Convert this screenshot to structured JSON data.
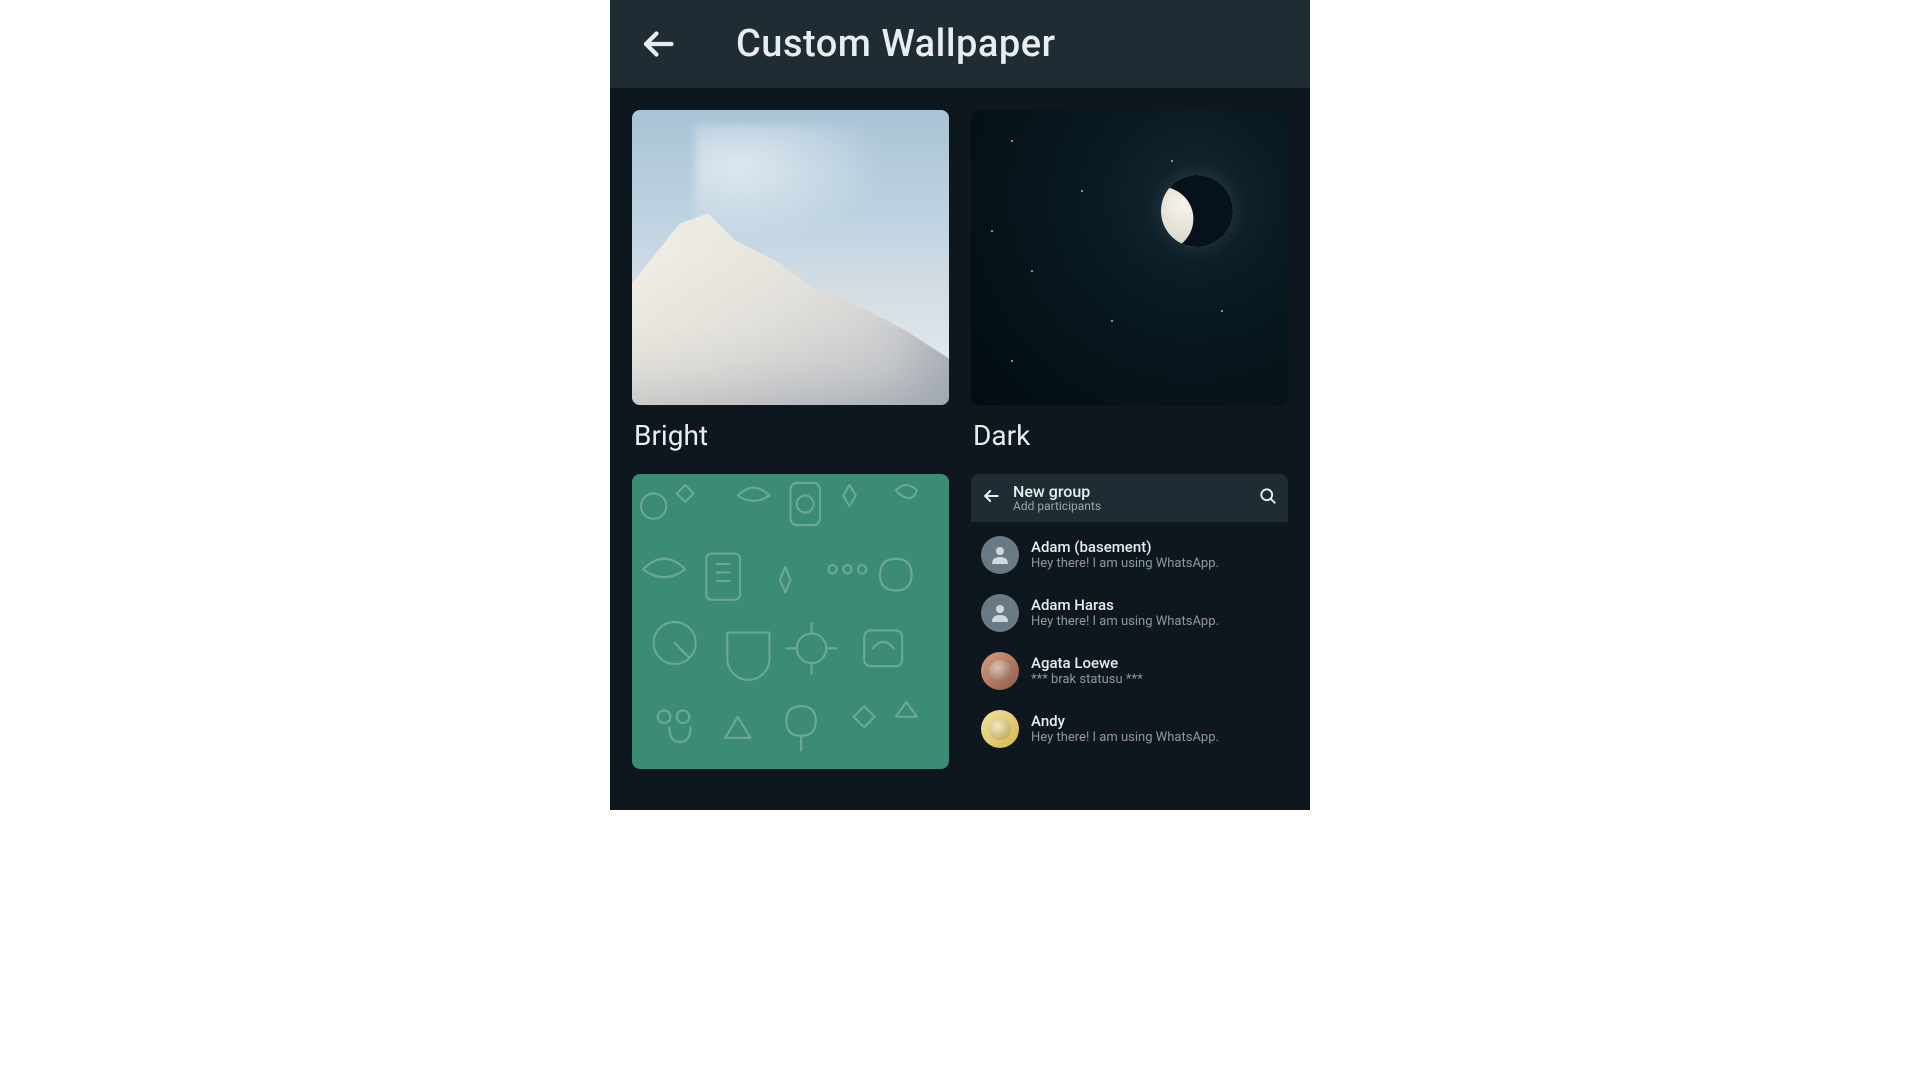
{
  "header": {
    "title": "Custom Wallpaper"
  },
  "categories": {
    "bright": "Bright",
    "dark": "Dark"
  },
  "newgroup": {
    "title": "New group",
    "subtitle": "Add participants",
    "contacts": [
      {
        "name": "Adam (basement)",
        "status": "Hey there! I am using WhatsApp."
      },
      {
        "name": "Adam Haras",
        "status": "Hey there! I am using WhatsApp."
      },
      {
        "name": "Agata Loewe",
        "status": "*** brak statusu ***"
      },
      {
        "name": "Andy",
        "status": "Hey there! I am using WhatsApp."
      }
    ]
  }
}
